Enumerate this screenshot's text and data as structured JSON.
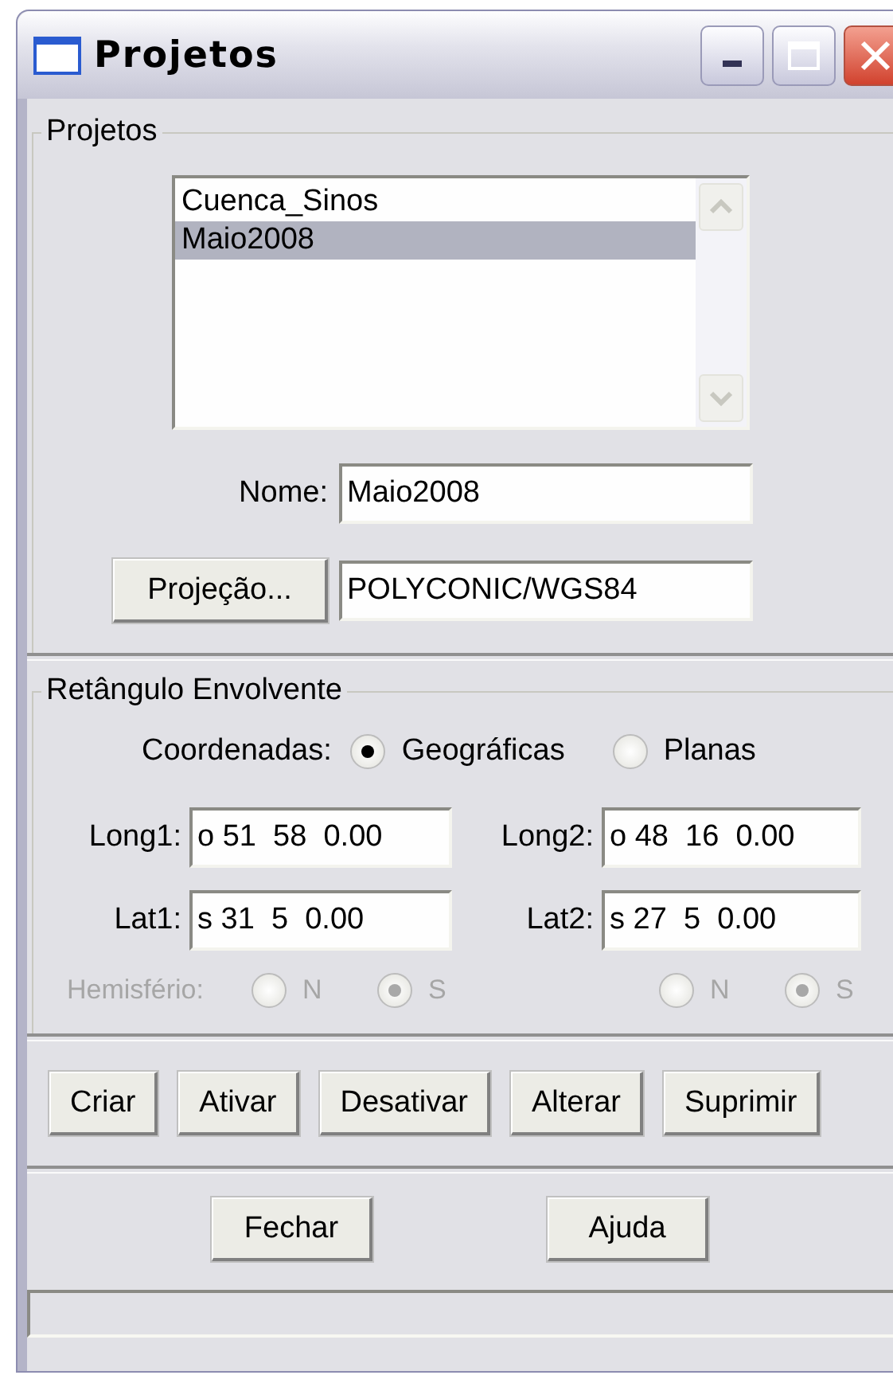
{
  "window": {
    "title": "Projetos"
  },
  "projects_group": {
    "title": "Projetos",
    "list": [
      {
        "label": "Cuenca_Sinos",
        "selected": false
      },
      {
        "label": "Maio2008",
        "selected": true
      }
    ],
    "name_label": "Nome:",
    "name_value": "Maio2008",
    "projection_button": "Projeção...",
    "projection_value": "POLYCONIC/WGS84"
  },
  "bounding_group": {
    "title": "Retângulo Envolvente",
    "coordinates_label": "Coordenadas:",
    "coordinates_options": [
      {
        "label": "Geográficas",
        "selected": true
      },
      {
        "label": "Planas",
        "selected": false
      }
    ],
    "fields": [
      {
        "label": "Long1:",
        "value": "o 51  58  0.00"
      },
      {
        "label": "Long2:",
        "value": "o 48  16  0.00"
      },
      {
        "label": "Lat1:",
        "value": "s 31  5  0.00"
      },
      {
        "label": "Lat2:",
        "value": "s 27  5  0.00"
      }
    ],
    "hemisphere": {
      "label": "Hemisfério:",
      "disabled": true,
      "options_left": [
        {
          "label": "N",
          "selected": false
        },
        {
          "label": "S",
          "selected": true
        }
      ],
      "options_right": [
        {
          "label": "N",
          "selected": false
        },
        {
          "label": "S",
          "selected": true
        }
      ]
    }
  },
  "actions": [
    "Criar",
    "Ativar",
    "Desativar",
    "Alterar",
    "Suprimir"
  ],
  "footer_buttons": [
    "Fechar",
    "Ajuda"
  ]
}
